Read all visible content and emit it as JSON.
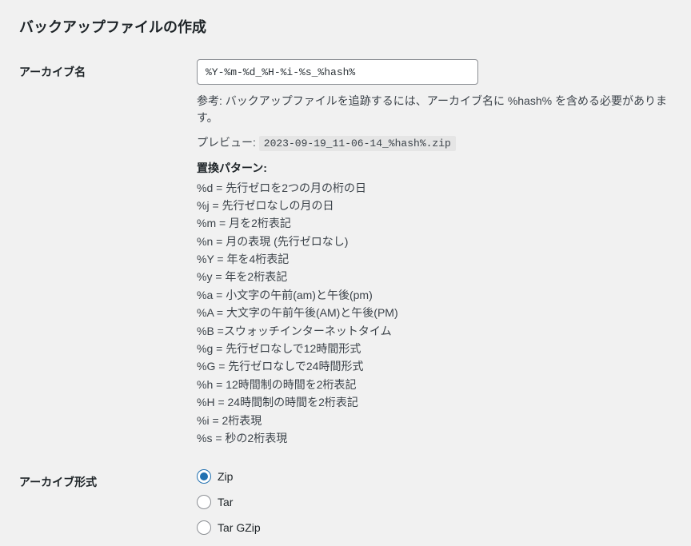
{
  "heading": "バックアップファイルの作成",
  "archive_name": {
    "label": "アーカイブ名",
    "value": "%Y-%m-%d_%H-%i-%s_%hash%",
    "help": "参考: バックアップファイルを追跡するには、アーカイブ名に %hash% を含める必要があります。",
    "preview_label": "プレビュー:",
    "preview_value": "2023-09-19_11-06-14_%hash%.zip",
    "patterns_title": "置換パターン:",
    "patterns": [
      "%d = 先行ゼロを2つの月の桁の日",
      "%j = 先行ゼロなしの月の日",
      "%m = 月を2桁表記",
      "%n = 月の表現 (先行ゼロなし)",
      "%Y = 年を4桁表記",
      "%y = 年を2桁表記",
      "%a = 小文字の午前(am)と午後(pm)",
      "%A = 大文字の午前午後(AM)と午後(PM)",
      "%B =スウォッチインターネットタイム",
      "%g = 先行ゼロなしで12時間形式",
      "%G = 先行ゼロなしで24時間形式",
      "%h = 12時間制の時間を2桁表記",
      "%H = 24時間制の時間を2桁表記",
      "%i = 2桁表現",
      "%s = 秒の2桁表現"
    ]
  },
  "archive_format": {
    "label": "アーカイブ形式",
    "options": [
      {
        "label": "Zip",
        "checked": true
      },
      {
        "label": "Tar",
        "checked": false
      },
      {
        "label": "Tar GZip",
        "checked": false
      }
    ]
  }
}
